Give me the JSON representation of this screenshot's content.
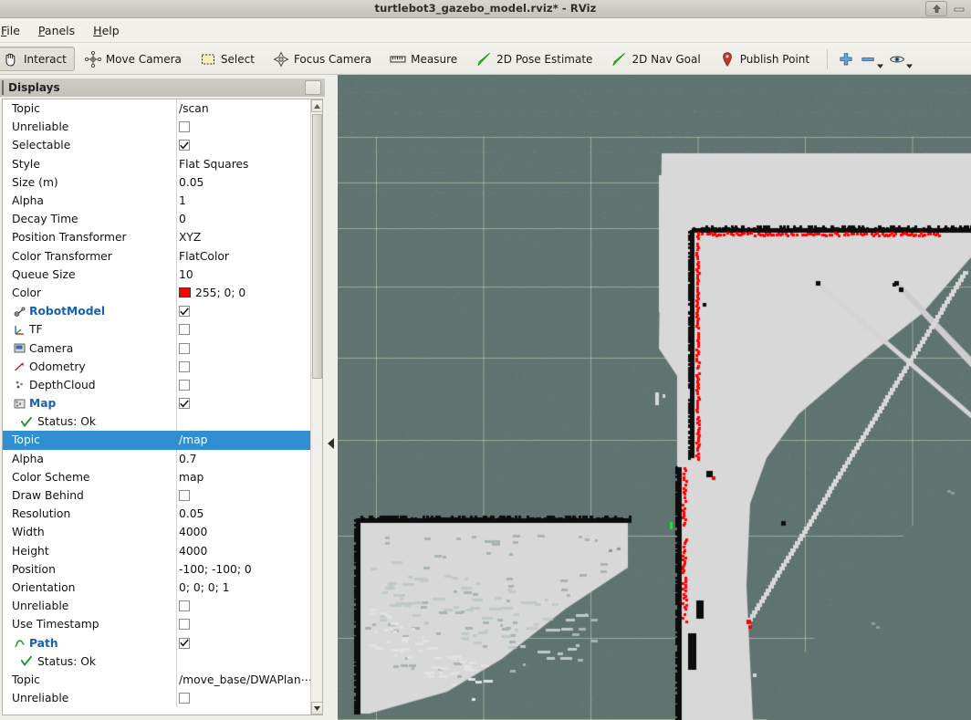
{
  "window": {
    "title": "turtlebot3_gazebo_model.rviz* - RViz",
    "buttons": [
      {
        "name": "restore-button",
        "icon": "up-arrow-icon"
      },
      {
        "name": "minimize-button",
        "icon": "minimize-icon"
      }
    ]
  },
  "menubar": {
    "items": [
      {
        "label": "File",
        "mnemonic": "F"
      },
      {
        "label": "Panels",
        "mnemonic": "P"
      },
      {
        "label": "Help",
        "mnemonic": "H"
      }
    ]
  },
  "toolbar": {
    "tools": [
      {
        "label": "Interact",
        "icon": "hand-cursor-icon",
        "checked": true
      },
      {
        "label": "Move Camera",
        "icon": "move-camera-icon",
        "checked": false
      },
      {
        "label": "Select",
        "icon": "select-rectangle-icon",
        "checked": false
      },
      {
        "label": "Focus Camera",
        "icon": "focus-camera-icon",
        "checked": false
      },
      {
        "label": "Measure",
        "icon": "ruler-icon",
        "checked": false
      },
      {
        "label": "2D Pose Estimate",
        "icon": "green-arrow-icon",
        "checked": false
      },
      {
        "label": "2D Nav Goal",
        "icon": "green-arrow-icon",
        "checked": false
      },
      {
        "label": "Publish Point",
        "icon": "map-pin-icon",
        "checked": false
      }
    ],
    "extra": [
      {
        "name": "add-tool-button",
        "icon": "plus-icon",
        "has_menu": false
      },
      {
        "name": "remove-tool-button",
        "icon": "minus-icon",
        "has_menu": true
      },
      {
        "name": "tool-properties-button",
        "icon": "eye-icon",
        "has_menu": true
      }
    ]
  },
  "displays_panel": {
    "title": "Displays",
    "float_button": "undock-button",
    "rows": [
      {
        "name": "Topic",
        "value": "/scan",
        "type": "text"
      },
      {
        "name": "Unreliable",
        "value": "",
        "type": "checkbox",
        "checked": false
      },
      {
        "name": "Selectable",
        "value": "",
        "type": "checkbox",
        "checked": true
      },
      {
        "name": "Style",
        "value": "Flat Squares",
        "type": "text"
      },
      {
        "name": "Size (m)",
        "value": "0.05",
        "type": "text"
      },
      {
        "name": "Alpha",
        "value": "1",
        "type": "text"
      },
      {
        "name": "Decay Time",
        "value": "0",
        "type": "text"
      },
      {
        "name": "Position Transformer",
        "value": "XYZ",
        "type": "text"
      },
      {
        "name": "Color Transformer",
        "value": "FlatColor",
        "type": "text"
      },
      {
        "name": "Queue Size",
        "value": "10",
        "type": "text"
      },
      {
        "name": "Color",
        "value": "255; 0; 0",
        "type": "color",
        "color": "#ff0000"
      },
      {
        "name": "RobotModel",
        "value": "",
        "type": "checkbox",
        "checked": true,
        "display": true,
        "icon": "robot-model-icon"
      },
      {
        "name": "TF",
        "value": "",
        "type": "checkbox",
        "checked": false,
        "display": false,
        "icon": "tf-axes-icon"
      },
      {
        "name": "Camera",
        "value": "",
        "type": "checkbox",
        "checked": false,
        "display": false,
        "icon": "camera-icon"
      },
      {
        "name": "Odometry",
        "value": "",
        "type": "checkbox",
        "checked": false,
        "display": false,
        "icon": "odometry-icon"
      },
      {
        "name": "DepthCloud",
        "value": "",
        "type": "checkbox",
        "checked": false,
        "display": false,
        "icon": "depthcloud-icon"
      },
      {
        "name": "Map",
        "value": "",
        "type": "checkbox",
        "checked": true,
        "display": true,
        "icon": "map-icon"
      },
      {
        "name": "Status: Ok",
        "value": "",
        "type": "status"
      },
      {
        "name": "Topic",
        "value": "/map",
        "type": "text",
        "selected": true
      },
      {
        "name": "Alpha",
        "value": "0.7",
        "type": "text"
      },
      {
        "name": "Color Scheme",
        "value": "map",
        "type": "text"
      },
      {
        "name": "Draw Behind",
        "value": "",
        "type": "checkbox",
        "checked": false
      },
      {
        "name": "Resolution",
        "value": "0.05",
        "type": "text"
      },
      {
        "name": "Width",
        "value": "4000",
        "type": "text"
      },
      {
        "name": "Height",
        "value": "4000",
        "type": "text"
      },
      {
        "name": "Position",
        "value": "-100; -100; 0",
        "type": "text"
      },
      {
        "name": "Orientation",
        "value": "0; 0; 0; 1",
        "type": "text"
      },
      {
        "name": "Unreliable",
        "value": "",
        "type": "checkbox",
        "checked": false
      },
      {
        "name": "Use Timestamp",
        "value": "",
        "type": "checkbox",
        "checked": false
      },
      {
        "name": "Path",
        "value": "",
        "type": "checkbox",
        "checked": true,
        "display": true,
        "icon": "path-icon"
      },
      {
        "name": "Status: Ok",
        "value": "",
        "type": "status"
      },
      {
        "name": "Topic",
        "value": "/move_base/DWAPlan⋯",
        "type": "text"
      },
      {
        "name": "Unreliable",
        "value": "",
        "type": "checkbox",
        "checked": false
      }
    ]
  },
  "viewport": {
    "name": "rviz-3d-view",
    "background_color": "#5f7370",
    "grid_color": "#b9cdb0",
    "map_free_color": "#d8d8d8",
    "map_occupied_color": "#0c0c0c",
    "scan_color": "#ff0000",
    "robot_marker_color": "#3c3c3c",
    "heading_arrow_color": "#2bdd2b"
  },
  "splitter": {
    "name": "panel-collapse-handle",
    "icon": "left-triangle-icon"
  }
}
